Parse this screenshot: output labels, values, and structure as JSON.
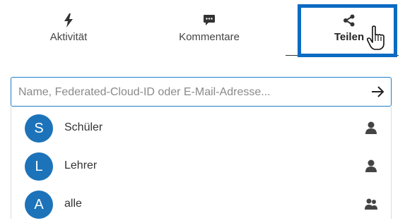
{
  "tabs": {
    "activity": {
      "label": "Aktivität",
      "icon": "lightning-icon"
    },
    "comments": {
      "label": "Kommentare",
      "icon": "comment-icon"
    },
    "share": {
      "label": "Teilen",
      "icon": "share-icon",
      "active": true
    }
  },
  "search": {
    "placeholder": "Name, Federated-Cloud-ID oder E-Mail-Adresse...",
    "value": "",
    "submit_icon": "arrow-right-icon"
  },
  "results": [
    {
      "initial": "S",
      "name": "Schüler",
      "icon": "user-icon"
    },
    {
      "initial": "L",
      "name": "Lehrer",
      "icon": "user-icon"
    },
    {
      "initial": "A",
      "name": "alle",
      "icon": "group-icon"
    }
  ],
  "colors": {
    "accent": "#0c6bc2",
    "avatar": "#1c73b9",
    "search_border": "#1f7fc8"
  }
}
